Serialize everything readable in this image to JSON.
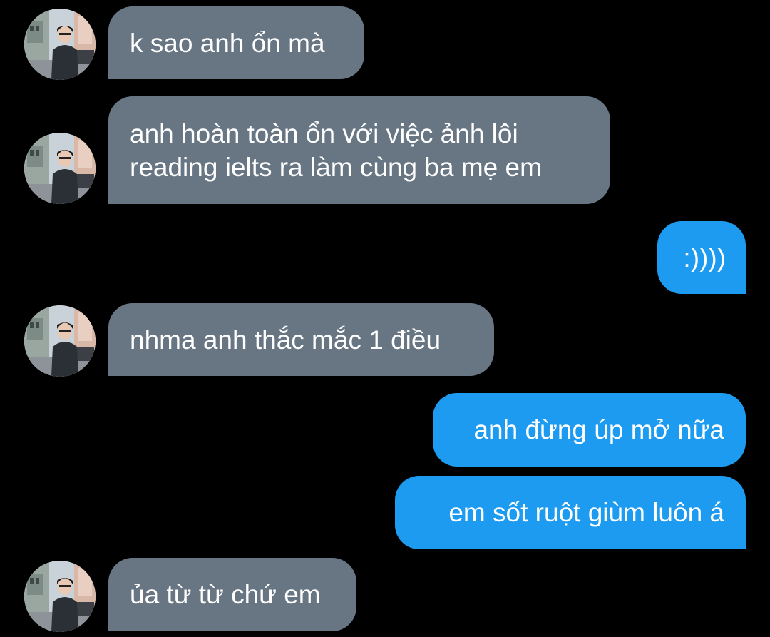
{
  "colors": {
    "background": "#000000",
    "incoming_bubble": "#687684",
    "outgoing_bubble": "#1d9bf0",
    "text": "#ffffff"
  },
  "messages": [
    {
      "sender": "other",
      "lines": [
        "k sao anh ổn mà"
      ]
    },
    {
      "sender": "other",
      "lines": [
        "anh hoàn toàn ổn với việc ảnh lôi",
        "reading ielts ra làm cùng ba mẹ em"
      ]
    },
    {
      "sender": "me",
      "lines": [
        ":))))"
      ]
    },
    {
      "sender": "other",
      "lines": [
        "nhma anh thắc mắc 1 điều"
      ]
    },
    {
      "sender": "me",
      "lines": [
        "anh đừng úp mở nữa"
      ]
    },
    {
      "sender": "me",
      "lines": [
        "em sốt ruột giùm luôn á"
      ]
    },
    {
      "sender": "other",
      "lines": [
        "ủa từ từ chứ em"
      ]
    }
  ]
}
